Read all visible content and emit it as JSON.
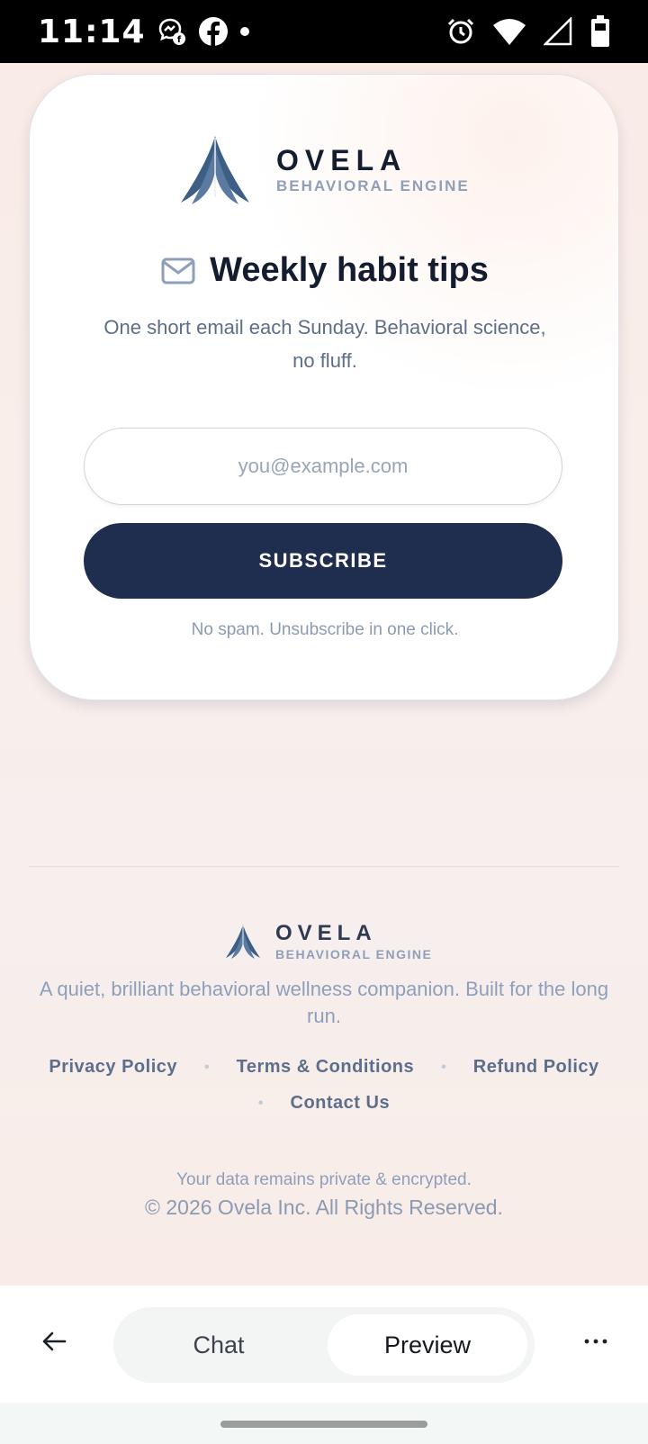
{
  "status_bar": {
    "time": "11:14",
    "icons": [
      "messenger-icon",
      "facebook-icon",
      "dot-icon",
      "alarm-icon",
      "wifi-icon",
      "signal-icon",
      "battery-icon"
    ]
  },
  "card": {
    "brand_name": "OVELA",
    "brand_sub": "BEHAVIORAL ENGINE",
    "headline": "Weekly habit tips",
    "subtitle": "One short email each Sunday. Behavioral science, no fluff.",
    "email_placeholder": "you@example.com",
    "email_value": "",
    "subscribe_label": "SUBSCRIBE",
    "no_spam": "No spam. Unsubscribe in one click."
  },
  "footer": {
    "brand_name": "OVELA",
    "brand_sub": "BEHAVIORAL ENGINE",
    "tagline": "A quiet, brilliant behavioral wellness companion. Built for the long run.",
    "links": {
      "privacy": "Privacy Policy",
      "terms": "Terms & Conditions",
      "refund": "Refund Policy",
      "contact": "Contact Us"
    },
    "privacy_note": "Your data remains private & encrypted.",
    "copyright": "© 2026 Ovela Inc. All Rights Reserved."
  },
  "bottom_bar": {
    "tab_chat": "Chat",
    "tab_preview": "Preview",
    "active_tab": "Preview"
  },
  "colors": {
    "navy": "#1f2d4f",
    "logo_blue": "#3d5f86",
    "background": "#f8ece7"
  }
}
